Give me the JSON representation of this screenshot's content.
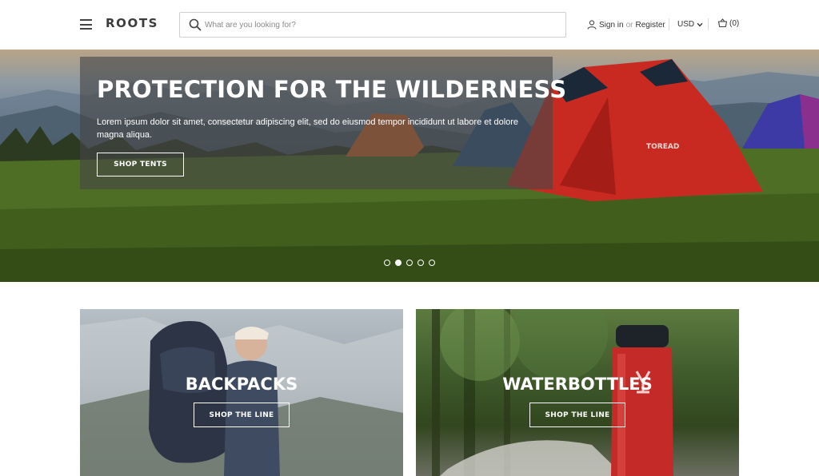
{
  "header": {
    "logo": "ROOTS",
    "search_placeholder": "What are you looking for?",
    "sign_in": "Sign in",
    "or": "or",
    "register": "Register",
    "currency": "USD",
    "cart": "(0)"
  },
  "hero": {
    "title": "PROTECTION FOR THE WILDERNESS",
    "text": "Lorem ipsum dolor sit amet, consectetur adipiscing elit, sed do eiusmod tempor incididunt ut labore et dolore magna aliqua.",
    "button": "SHOP TENTS",
    "tent_brand": "TOREAD",
    "slides_count": 5,
    "active_slide": 2
  },
  "categories": [
    {
      "title": "BACKPACKS",
      "button": "SHOP THE LINE"
    },
    {
      "title": "WATERBOTTLES",
      "button": "SHOP THE LINE"
    }
  ]
}
